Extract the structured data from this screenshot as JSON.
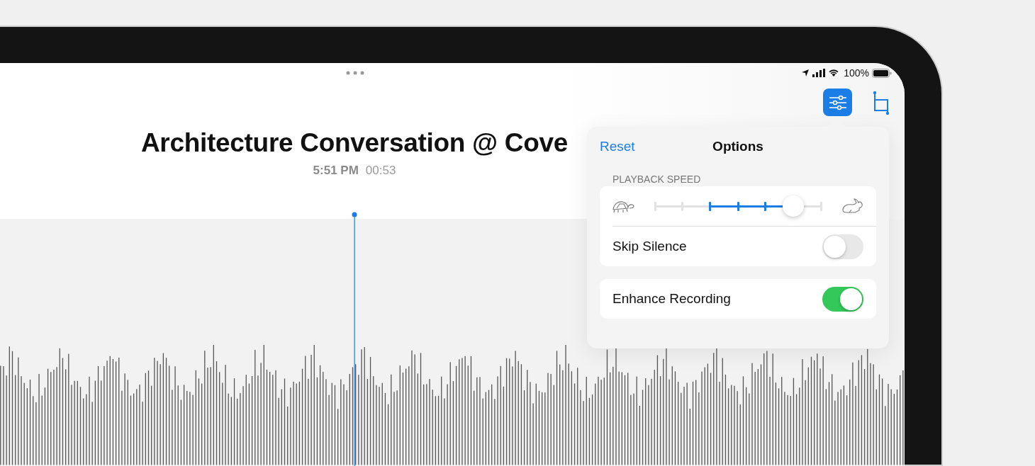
{
  "status_bar": {
    "battery": "100%"
  },
  "recording": {
    "title": "Architecture Conversation @ Cove",
    "time": "5:51 PM",
    "duration": "00:53"
  },
  "toolbar": {
    "options_selected": true
  },
  "options": {
    "title": "Options",
    "reset": "Reset",
    "speed": {
      "label": "PLAYBACK SPEED",
      "level": 0.833,
      "skip_silence": {
        "label": "Skip Silence",
        "on": false
      }
    },
    "enhance": {
      "label": "Enhance Recording",
      "on": true
    }
  }
}
